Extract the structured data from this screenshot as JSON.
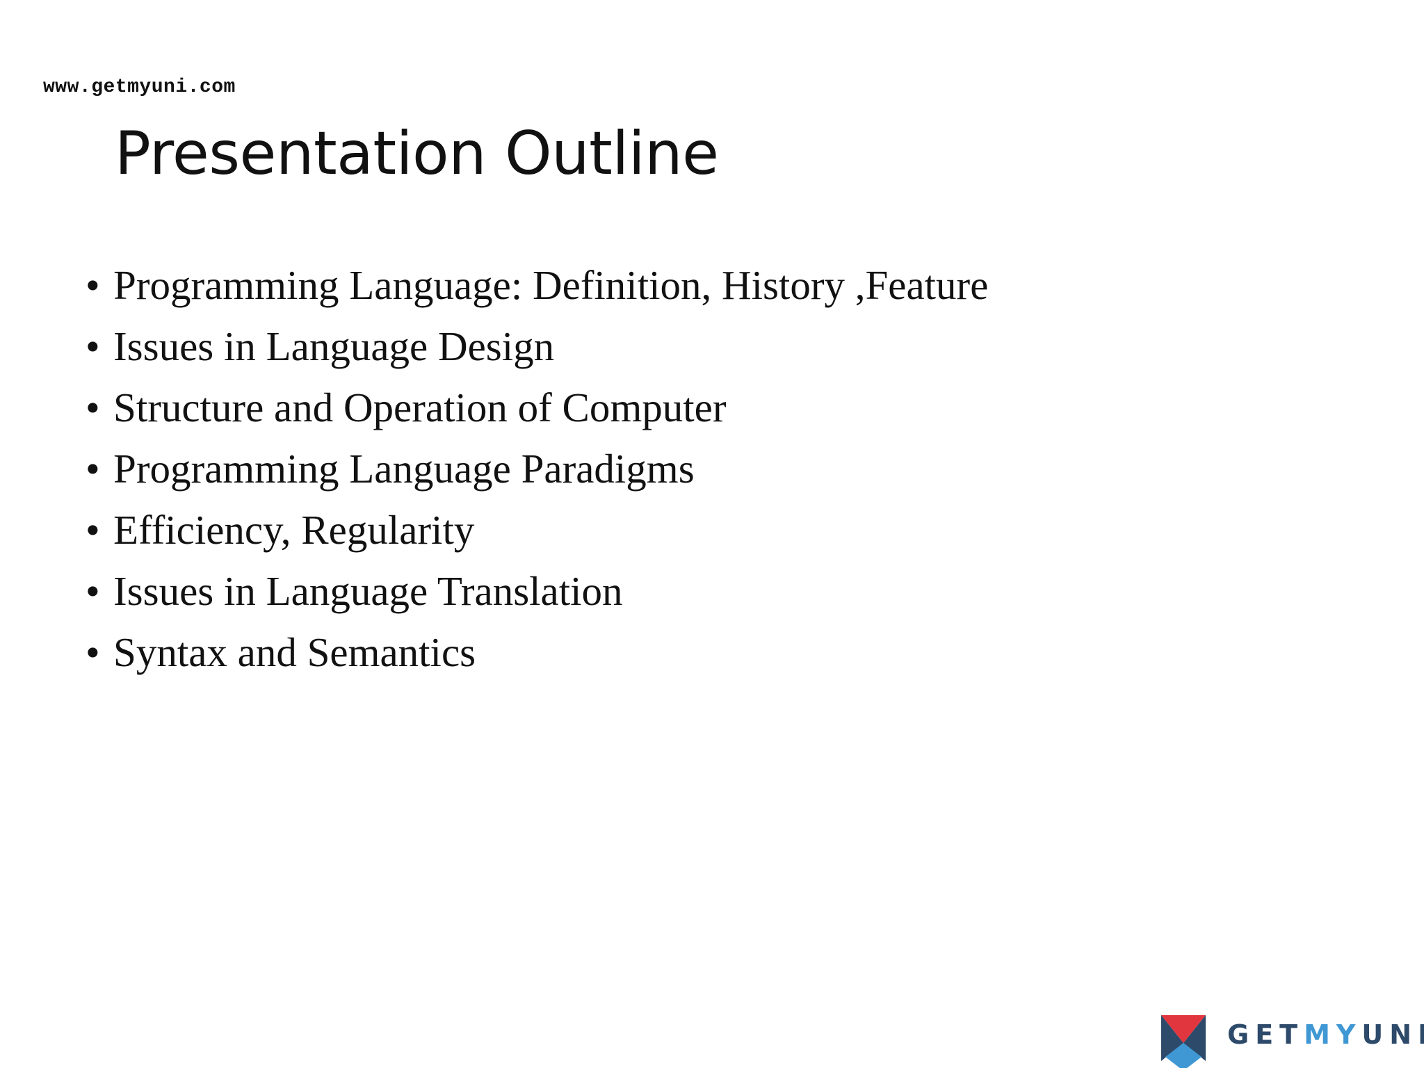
{
  "website": "www.getmyuni.com",
  "title": "Presentation Outline",
  "bullet_symbol": "•",
  "bullets": [
    "Programming  Language:  Definition, History ,Feature",
    "Issues in Language  Design",
    "Structure and Operation of Computer",
    "Programming  Language  Paradigms",
    "Efficiency,  Regularity",
    "Issues in Language  Translation",
    "Syntax and Semantics"
  ],
  "logo": {
    "text_part1": "GET",
    "text_part2": "MY",
    "text_part3": "UNI",
    "colors": {
      "dark": "#2d4a6a",
      "red": "#e2363f",
      "blue": "#3f97d3"
    }
  }
}
